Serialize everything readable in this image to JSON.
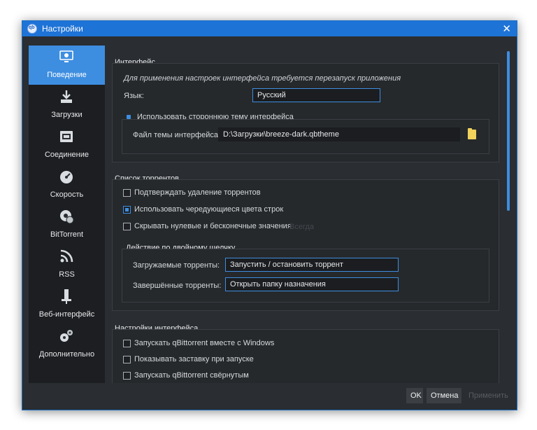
{
  "window": {
    "title": "Настройки",
    "close_glyph": "✕"
  },
  "colors": {
    "accent": "#3d8ee0",
    "titlebar": "#1e73d6",
    "background": "#2a2d31",
    "sidebar": "#1c1e21"
  },
  "sidebar": {
    "items": [
      {
        "label": "Поведение",
        "icon": "monitor-gear-icon",
        "active": true
      },
      {
        "label": "Загрузки",
        "icon": "download-icon",
        "active": false
      },
      {
        "label": "Соединение",
        "icon": "network-icon",
        "active": false
      },
      {
        "label": "Скорость",
        "icon": "speedometer-icon",
        "active": false
      },
      {
        "label": "BitTorrent",
        "icon": "gear-globe-icon",
        "active": false
      },
      {
        "label": "RSS",
        "icon": "rss-icon",
        "active": false
      },
      {
        "label": "Веб-интерфейс",
        "icon": "web-ui-icon",
        "active": false
      },
      {
        "label": "Дополнительно",
        "icon": "gears-icon",
        "active": false
      }
    ]
  },
  "interface": {
    "title": "Интерфейс",
    "hint": "Для применения настроек интерфейса требуется перезапуск приложения",
    "language_label": "Язык:",
    "language_value": "Русский",
    "custom_theme_label": "Использовать стороннюю тему интерфейса",
    "custom_theme_checked": true,
    "theme_file_label": "Файл темы интерфейса:",
    "theme_file_value": "D:\\Загрузки\\breeze-dark.qbtheme"
  },
  "torrent_list": {
    "title": "Список торрентов",
    "confirm_delete": {
      "label": "Подтверждать удаление торрентов",
      "checked": false
    },
    "alt_row_colors": {
      "label": "Использовать чередующиеся цвета строк",
      "checked": true
    },
    "hide_zero": {
      "label": "Скрывать нулевые и бесконечные значения",
      "checked": false
    },
    "hide_zero_option": "Всегда",
    "double_click": {
      "title": "Действие по двойному щелчку",
      "downloading_label": "Загружаемые торренты:",
      "downloading_value": "Запустить / остановить торрент",
      "completed_label": "Завершённые торренты:",
      "completed_value": "Открыть папку назначения"
    }
  },
  "desktop": {
    "title": "Настройки интерфейса",
    "start_with_windows": {
      "label": "Запускать qBittorrent вместе с Windows",
      "checked": false
    },
    "show_splash": {
      "label": "Показывать заставку при запуске",
      "checked": false
    },
    "start_minimized": {
      "label": "Запускать qBittorrent свёрнутым",
      "checked": false
    }
  },
  "buttons": {
    "ok": "OK",
    "cancel": "Отмена",
    "apply": "Применить"
  }
}
